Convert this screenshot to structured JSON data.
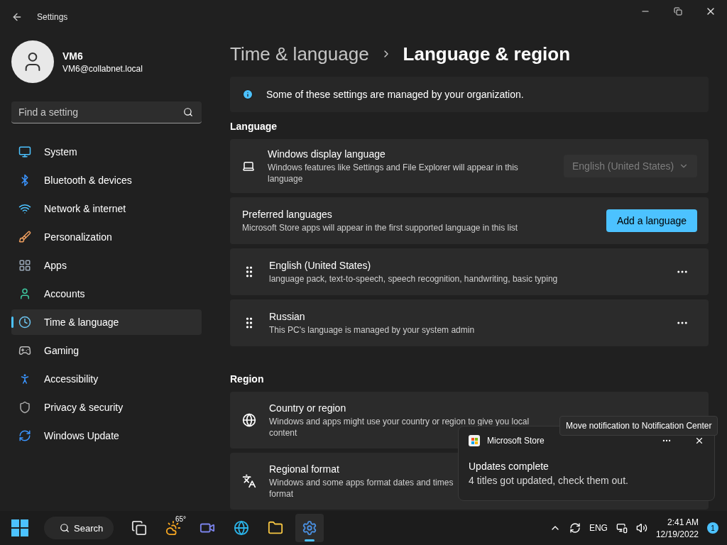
{
  "window": {
    "title": "Settings"
  },
  "user": {
    "name": "VM6",
    "email": "VM6@collabnet.local"
  },
  "search": {
    "placeholder": "Find a setting"
  },
  "nav": [
    {
      "label": "System",
      "kind": "system",
      "selected": false
    },
    {
      "label": "Bluetooth & devices",
      "kind": "bluetooth",
      "selected": false
    },
    {
      "label": "Network & internet",
      "kind": "network",
      "selected": false
    },
    {
      "label": "Personalization",
      "kind": "brush",
      "selected": false
    },
    {
      "label": "Apps",
      "kind": "apps",
      "selected": false
    },
    {
      "label": "Accounts",
      "kind": "accounts",
      "selected": false
    },
    {
      "label": "Time & language",
      "kind": "time",
      "selected": true
    },
    {
      "label": "Gaming",
      "kind": "gaming",
      "selected": false
    },
    {
      "label": "Accessibility",
      "kind": "accessibility",
      "selected": false
    },
    {
      "label": "Privacy & security",
      "kind": "privacy",
      "selected": false
    },
    {
      "label": "Windows Update",
      "kind": "update",
      "selected": false
    }
  ],
  "breadcrumb": [
    "Time & language",
    "Language & region"
  ],
  "banner": {
    "text": "Some of these settings are managed by your organization."
  },
  "sections": [
    {
      "title": "Language",
      "rows": [
        {
          "kind": "dropdown",
          "title": "Windows display language",
          "description": "Windows features like Settings and File Explorer will appear in this language",
          "value": "English (United States)",
          "disabled": true
        },
        {
          "kind": "button",
          "title": "Preferred languages",
          "description": "Microsoft Store apps will appear in the first supported language in this list",
          "button": "Add a language"
        },
        {
          "kind": "language",
          "title": "English (United States)",
          "description": "language pack, text-to-speech, speech recognition, handwriting, basic typing"
        },
        {
          "kind": "language",
          "title": "Russian",
          "description": "This PC's language is managed by your system admin"
        }
      ]
    },
    {
      "title": "Region",
      "rows": [
        {
          "kind": "country",
          "title": "Country or region",
          "description": [
            "Windows and apps might use your country or region to give you local",
            "content"
          ]
        },
        {
          "kind": "format",
          "title": "Regional format",
          "description": [
            "Windows and some apps format dates and times",
            "format"
          ]
        }
      ]
    }
  ],
  "notification": {
    "app": "Microsoft Store",
    "title": "Updates complete",
    "body": "4 titles got updated, check them out.",
    "tooltip": "Move notification to Notification Center"
  },
  "taskbar": {
    "search": "Search",
    "weather": "65°",
    "apps": [
      {
        "kind": "taskview",
        "selected": false
      },
      {
        "kind": "weather",
        "selected": false
      },
      {
        "kind": "chat",
        "selected": false
      },
      {
        "kind": "edge",
        "selected": false
      },
      {
        "kind": "explorer",
        "selected": false
      },
      {
        "kind": "settings",
        "selected": true
      }
    ],
    "language": "ENG",
    "time": "2:41 AM",
    "date": "12/19/2022",
    "badge": "1"
  }
}
